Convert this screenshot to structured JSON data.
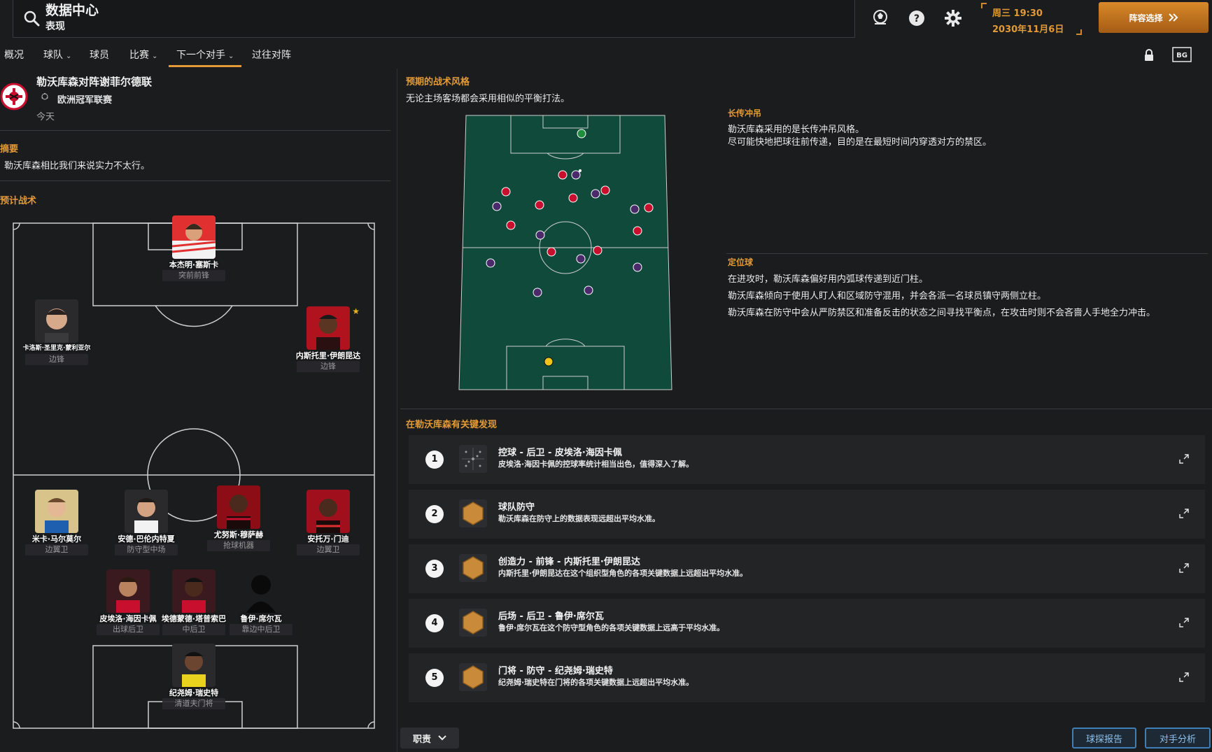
{
  "header": {
    "title": "数据中心",
    "subtitle": "表现",
    "weekday_time": "周三 19:30",
    "date": "2030年11月6日",
    "lineup_button": "阵容选择"
  },
  "nav": {
    "tabs": [
      {
        "label": "概况"
      },
      {
        "label": "球队"
      },
      {
        "label": "球员"
      },
      {
        "label": "比赛"
      },
      {
        "label": "下一个对手"
      },
      {
        "label": "过往对阵"
      }
    ],
    "bg_label": "BG"
  },
  "match": {
    "title": "勒沃库森对阵谢菲尔德联",
    "competition": "欧洲冠军联赛",
    "day": "今天"
  },
  "summary": {
    "heading": "摘要",
    "text": "勒沃库森相比我们来说实力不太行。"
  },
  "tactics": {
    "heading": "预计战术",
    "players": [
      {
        "name": "本杰明·塞斯卡",
        "role": "突前前锋"
      },
      {
        "name": "卡洛斯·圣里克·蒙利亚尔",
        "role": "边锋"
      },
      {
        "name": "内斯托里·伊朗昆达",
        "role": "边锋"
      },
      {
        "name": "米卡·马尔莫尔",
        "role": "边翼卫"
      },
      {
        "name": "安德·巴伦内特夏",
        "role": "防守型中场"
      },
      {
        "name": "尤努斯·穆萨赫",
        "role": "抢球机器"
      },
      {
        "name": "安托万·门迪",
        "role": "边翼卫"
      },
      {
        "name": "皮埃洛·海因卡佩",
        "role": "出球后卫"
      },
      {
        "name": "埃德蒙德·塔普索巴",
        "role": "中后卫"
      },
      {
        "name": "鲁伊·席尔瓦",
        "role": "靠边中后卫"
      },
      {
        "name": "纪尧姆·瑞史特",
        "role": "清道夫门将"
      }
    ]
  },
  "style": {
    "heading": "预期的战术风格",
    "desc": "无论主场客场都会采用相似的平衡打法。",
    "long_ball": {
      "heading": "长传冲吊",
      "line1": "勒沃库森采用的是长传冲吊风格。",
      "line2": "尽可能快地把球往前传递，目的是在最短时间内穿透对方的禁区。"
    },
    "set_pieces": {
      "heading": "定位球",
      "lines": [
        "在进攻时，勒沃库森偏好用内弧球传递到近门柱。",
        "勒沃库森倾向于使用人盯人和区域防守混用，并会各派一名球员镇守两侧立柱。",
        "勒沃库森在防守中会从严防禁区和准备反击的状态之间寻找平衡点，在攻击时则不会吝啬人手地全力冲击。"
      ]
    }
  },
  "key_findings": {
    "heading": "在勒沃库森有关键发现",
    "items": [
      {
        "num": "1",
        "title": "控球 - 后卫 - 皮埃洛·海因卡佩",
        "desc": "皮埃洛·海因卡佩的控球率统计相当出色，值得深入了解。",
        "icon": "grid-stats-icon"
      },
      {
        "num": "2",
        "title": "球队防守",
        "desc": "勒沃库森在防守上的数据表现远超出平均水准。",
        "icon": "hexagon-stats-icon"
      },
      {
        "num": "3",
        "title": "创造力 - 前锋 - 内斯托里·伊朗昆达",
        "desc": "内斯托里·伊朗昆达在这个组织型角色的各项关键数据上远超出平均水准。",
        "icon": "hexagon-stats-icon"
      },
      {
        "num": "4",
        "title": "后场 - 后卫 - 鲁伊·席尔瓦",
        "desc": "鲁伊·席尔瓦在这个防守型角色的各项关键数据上远高于平均水准。",
        "icon": "hexagon-stats-icon"
      },
      {
        "num": "5",
        "title": "门将 - 防守 - 纪尧姆·瑞史特",
        "desc": "纪尧姆·瑞史特在门将的各项关键数据上远超出平均水准。",
        "icon": "hexagon-stats-icon"
      }
    ]
  },
  "bottom": {
    "role_dropdown": "职责",
    "scout_report": "球探报告",
    "opponent_analysis": "对手分析"
  },
  "colors": {
    "accent": "#e39a36",
    "pitch": "#0f4a3a",
    "team_red": "#c8102e",
    "team_purple": "#4a2a6b"
  }
}
